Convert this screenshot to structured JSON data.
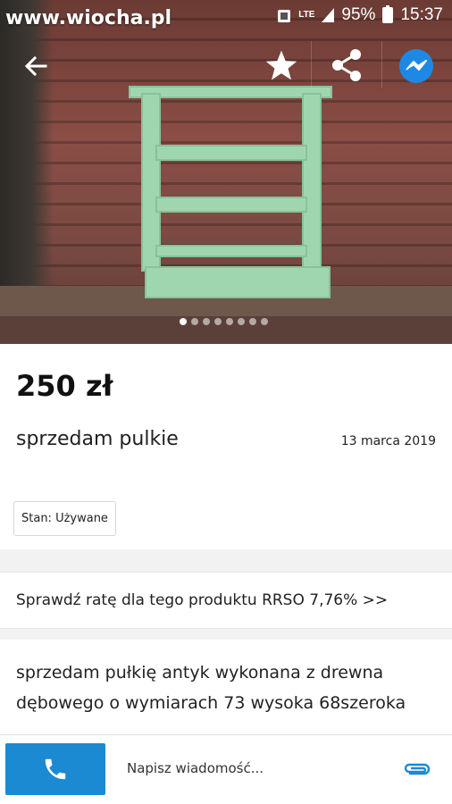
{
  "status_bar": {
    "watermark": "www.wiocha.pl",
    "network": "LTE",
    "battery": "95%",
    "time": "15:37"
  },
  "toolbar": {
    "back_icon": "arrow-left-icon",
    "star_icon": "star-icon",
    "share_icon": "share-icon",
    "messenger_icon": "messenger-icon",
    "messenger_color": "#1e88e5"
  },
  "gallery": {
    "image_count": 8,
    "active_index": 0
  },
  "listing": {
    "price": "250 zł",
    "title": "sprzedam pulkie",
    "date": "13 marca 2019",
    "condition": "Stan: Używane"
  },
  "rate": {
    "label": "Sprawdź ratę dla tego produktu RRSO 7,76% >>"
  },
  "description": {
    "line1": "sprzedam pułkię antyk wykonana z drewna",
    "line2": "dębowego  o wymiarach 73 wysoka 68szeroka"
  },
  "bottom_bar": {
    "call_icon": "phone-icon",
    "call_color": "#1b8ad3",
    "message_placeholder": "Napisz wiadomość...",
    "attach_icon": "paperclip-icon",
    "attach_color": "#1b8ad3"
  }
}
